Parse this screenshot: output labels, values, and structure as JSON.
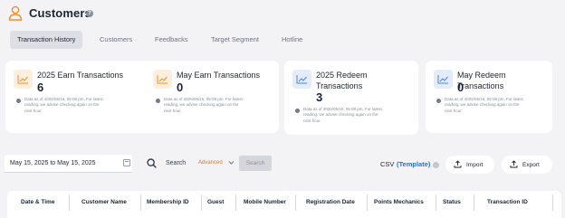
{
  "page": {
    "title": "Customers",
    "help_icon": "?"
  },
  "tabs": [
    {
      "label": "Transaction History",
      "active": true
    },
    {
      "label": "Customers",
      "active": false
    },
    {
      "label": "Feedbacks",
      "active": false
    },
    {
      "label": "Target Segment",
      "active": false
    },
    {
      "label": "Hotline",
      "active": false
    }
  ],
  "cards": [
    {
      "title": "2025 Earn Transactions",
      "value": "6",
      "icon": "trend-up-icon",
      "icon_bg": "#fdefdc",
      "icon_color": "#ee8f2a",
      "note": [
        "Data as of 2025/05/15, 05:08 pm. For latest",
        "reading, we advise checking again on the",
        "next hour."
      ]
    },
    {
      "title": "May Earn Transactions",
      "value": "0",
      "icon": "trend-up-icon",
      "icon_bg": "#fdefdc",
      "icon_color": "#ee8f2a",
      "note": [
        "Data as of 2025/05/15, 05:08 pm. For latest",
        "reading, we advise checking again on the",
        "next hour."
      ]
    },
    {
      "title": "2025 Redeem Transactions",
      "value": "3",
      "icon": "trend-up-icon",
      "icon_bg": "#e3ecfb",
      "icon_color": "#4e84d8",
      "note": [
        "Data as of 2025/05/15, 05:08 pm. For latest",
        "reading, we advise checking again on the",
        "next hour."
      ]
    },
    {
      "title": "May Redeem Transactions",
      "value": "0",
      "icon": "trend-up-icon",
      "icon_bg": "#e3ecfb",
      "icon_color": "#4e84d8",
      "note": [
        "Data as of 2025/05/15, 05:08 pm. For latest",
        "reading, we advise checking again on the",
        "next hour."
      ]
    }
  ],
  "filters": {
    "date_range": "May 15, 2025 to May 15, 2025",
    "search_label": "Search",
    "search_mode": "Advanced",
    "search_button": "Search",
    "csv_label": "CSV",
    "csv_template": "(Template)",
    "import_label": "Import",
    "export_label": "Export"
  },
  "table": {
    "columns": [
      "Date & Time",
      "Customer Name",
      "Membership ID",
      "Guest",
      "Mobile Number",
      "Registration Date",
      "Points Mechanics",
      "Status",
      "Transaction ID"
    ]
  },
  "colors": {
    "accent_orange": "#e07a1e",
    "link_blue": "#2670d8",
    "page_bg": "#f3f3f6"
  }
}
